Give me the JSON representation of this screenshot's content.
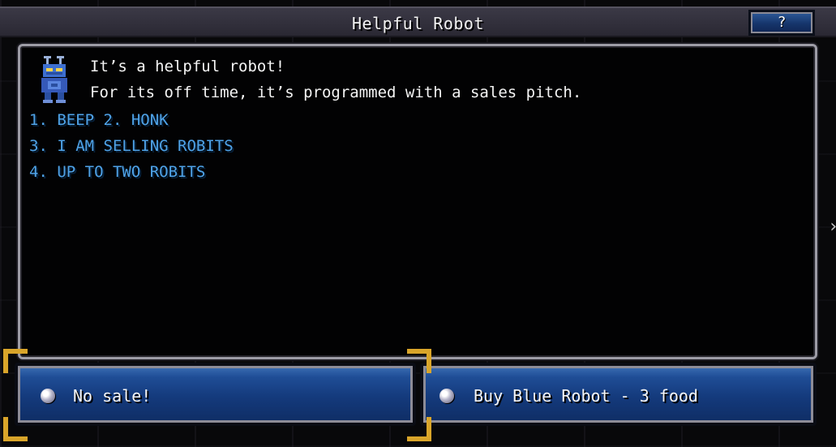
{
  "window": {
    "title": "Helpful Robot",
    "help_label": "?"
  },
  "dialog": {
    "portrait_icon": "blue-robot-icon",
    "message_lines": [
      "It’s a helpful robot!",
      "For its off time, it’s programmed with a sales pitch."
    ],
    "pitch_lines": [
      "1. BEEP 2. HONK",
      "3. I AM SELLING ROBITS",
      "4. UP TO TWO ROBITS"
    ]
  },
  "choices": [
    {
      "label": "No sale!",
      "icon": "bullet-orb-icon"
    },
    {
      "label": "Buy Blue Robot - 3 food",
      "icon": "bullet-orb-icon"
    }
  ],
  "colors": {
    "pitch_text": "#4fa3e8",
    "button_blue": "#1f4d96",
    "bracket_gold": "#d9a52a",
    "panel_border": "#9d9ca6"
  }
}
